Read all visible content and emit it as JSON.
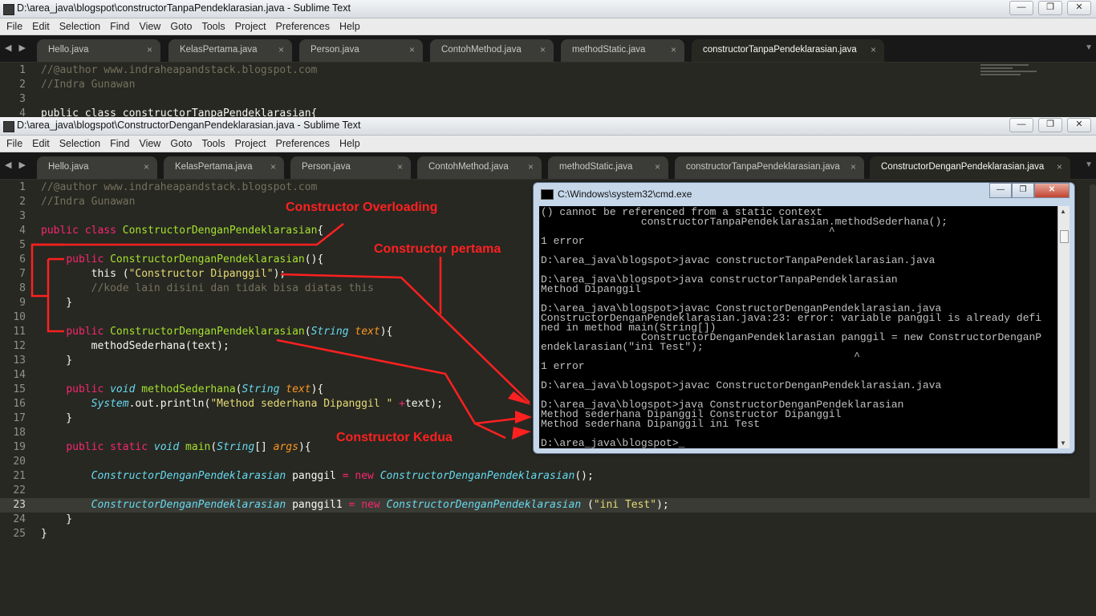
{
  "window_back": {
    "title": "D:\\area_java\\blogspot\\constructorTanpaPendeklarasian.java - Sublime Text",
    "tabs": [
      {
        "label": "Hello.java"
      },
      {
        "label": "KelasPertama.java"
      },
      {
        "label": "Person.java"
      },
      {
        "label": "ContohMethod.java"
      },
      {
        "label": "methodStatic.java"
      },
      {
        "label": "constructorTanpaPendeklarasian.java"
      }
    ],
    "lines": [
      {
        "num": "1",
        "text": "//@author www.indraheapandstack.blogspot.com"
      },
      {
        "num": "2",
        "text": "//Indra Gunawan"
      },
      {
        "num": "3",
        "text": ""
      },
      {
        "num": "4",
        "text": "public class constructorTanpaPendeklarasian{"
      }
    ]
  },
  "window_front": {
    "title": "D:\\area_java\\blogspot\\ConstructorDenganPendeklarasian.java - Sublime Text",
    "tabs": [
      {
        "label": "Hello.java"
      },
      {
        "label": "KelasPertama.java"
      },
      {
        "label": "Person.java"
      },
      {
        "label": "ContohMethod.java"
      },
      {
        "label": "methodStatic.java"
      },
      {
        "label": "constructorTanpaPendeklarasian.java"
      },
      {
        "label": "ConstructorDenganPendeklarasian.java"
      }
    ],
    "current_line": "23",
    "line_numbers": [
      "1",
      "2",
      "3",
      "4",
      "5",
      "6",
      "7",
      "8",
      "9",
      "10",
      "11",
      "12",
      "13",
      "14",
      "15",
      "16",
      "17",
      "18",
      "19",
      "20",
      "21",
      "22",
      "23",
      "24",
      "25"
    ]
  },
  "menu": [
    "File",
    "Edit",
    "Selection",
    "Find",
    "View",
    "Goto",
    "Tools",
    "Project",
    "Preferences",
    "Help"
  ],
  "window_buttons": {
    "minimize": "—",
    "maximize": "❐",
    "close": "✕"
  },
  "tab_close": "×",
  "cmd": {
    "title": "C:\\Windows\\system32\\cmd.exe",
    "lines": [
      "() cannot be referenced from a static context",
      "                constructorTanpaPendeklarasian.methodSederhana();",
      "                                              ^",
      "1 error",
      "",
      "D:\\area_java\\blogspot>javac constructorTanpaPendeklarasian.java",
      "",
      "D:\\area_java\\blogspot>java constructorTanpaPendeklarasian",
      "Method Dipanggil",
      "",
      "D:\\area_java\\blogspot>javac ConstructorDenganPendeklarasian.java",
      "ConstructorDenganPendeklarasian.java:23: error: variable panggil is already defi",
      "ned in method main(String[])",
      "                ConstructorDenganPendeklarasian panggil = new ConstructorDenganP",
      "endeklarasian(\"ini Test\");",
      "                                                  ^",
      "1 error",
      "",
      "D:\\area_java\\blogspot>javac ConstructorDenganPendeklarasian.java",
      "",
      "D:\\area_java\\blogspot>java ConstructorDenganPendeklarasian",
      "Method sederhana Dipanggil Constructor Dipanggil",
      "Method sederhana Dipanggil ini Test",
      "",
      "D:\\area_java\\blogspot>_"
    ]
  },
  "annotations": {
    "overloading": "Constructor Overloading",
    "pertama": "Constructor pertama",
    "kedua": "Constructor Kedua"
  },
  "colors": {
    "editor_bg": "#272822",
    "comment": "#75715e",
    "keyword": "#f92672",
    "function": "#a6e22e",
    "string": "#e6db74",
    "type": "#66d9ef",
    "param": "#fd971f",
    "annotation": "#ff2020"
  }
}
